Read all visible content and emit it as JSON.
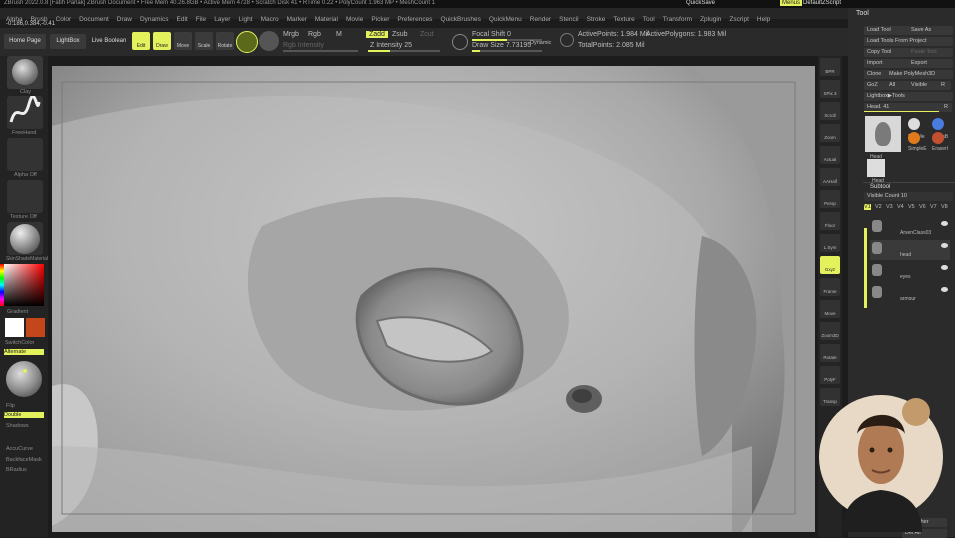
{
  "title_bar": {
    "text": "ZBrush 2022.0.8 [Fatih Parlak]   ZBrush Document   • Free Mem 40.26.8GB • Active Mem 4728 • Scratch Disk 41 • RTime 0.22 • PolyCount 1.963 MP • MeshCount 1"
  },
  "quick_buttons": {
    "quicksave": "QuickSave",
    "menus": "Menus",
    "default_script": "DefaultZScript"
  },
  "menu_items": [
    "Alpha",
    "Brush",
    "Color",
    "Document",
    "Draw",
    "Dynamics",
    "Edit",
    "File",
    "Layer",
    "Light",
    "Macro",
    "Marker",
    "Material",
    "Movie",
    "Picker",
    "Preferences",
    "QuickBrushes",
    "QuickMenu",
    "Render",
    "Stencil",
    "Stroke",
    "Texture",
    "Tool",
    "Transform",
    "Zplugin",
    "Zscript",
    "Help"
  ],
  "coordinates": "-0.186,0.384,-0.41",
  "shelf": {
    "home_page": "Home Page",
    "lightbox": "LightBox",
    "live_boolean": "Live Boolean",
    "edit": "Edit",
    "draw": "Draw",
    "move": "Move",
    "scale": "Scale",
    "rotate": "Rotate",
    "mrgb": "Mrgb",
    "rgb": "Rgb",
    "m": "M",
    "zadd": "Zadd",
    "zsub": "Zsub",
    "zcut": "Zcut",
    "rgb_intensity": "Rgb Intensity",
    "z_intensity": "Z Intensity 25",
    "focal_shift": "Focal Shift 0",
    "draw_size": "Draw Size 7.73195",
    "dynamic": "Dynamic",
    "active_points": "ActivePoints: 1.984 Mil",
    "active_polygons": "ActivePolygons: 1.983 Mil",
    "total_points": "TotalPoints: 2.085 Mil"
  },
  "left_panel": {
    "clay": "Clay",
    "freehand": "FreeHand",
    "alpha_off": "Alpha Off",
    "texture_off": "Texture Off",
    "material": "SkinShadeMaterial",
    "gradient": "Gradient",
    "switch_color": "SwitchColor",
    "alternate": "Alternate",
    "flip": "Flip",
    "double": "Double",
    "shadows": "Shadows",
    "accucurve": "AccuCurve",
    "backface": "BackfaceMask",
    "bradius": "BRadius",
    "colors": {
      "primary": "#ffffff",
      "secondary": "#c4471c",
      "accent": "#e3f15c"
    }
  },
  "right_strip": [
    "BPR",
    "SPix 3",
    "Scroll",
    "Zoom",
    "Actual",
    "AAHalf",
    "Persp",
    "Floor",
    "L.Sym",
    "Gxyz",
    "Frame",
    "Move",
    "Zoom3D",
    "Rotate",
    "PolyF",
    "Transp"
  ],
  "tool_panel": {
    "header": "Tool",
    "load_tool": "Load Tool",
    "save_as": "Save As",
    "load_from_project": "Load Tools From Project",
    "copy_tool": "Copy Tool",
    "paste_tool": "Paste Tool",
    "import": "Import",
    "export": "Export",
    "clone": "Clone",
    "make_polymesh": "Make PolyMesh3D",
    "goz": "GoZ",
    "all": "All",
    "visible": "Visible",
    "r": "R",
    "lightbox_tools": "Lightbox▶Tools",
    "head_slider": "Head. 41",
    "r2": "R",
    "thumbs": [
      "Head",
      "PolyMe",
      "AlphaB",
      "SimpleE",
      "EraserI",
      "Head"
    ],
    "subtool": "Subtool",
    "visible_count": "Visible Count 10",
    "v_levels": [
      "V1",
      "V2",
      "V3",
      "V4",
      "V5",
      "V6",
      "V7",
      "V8"
    ],
    "subtools": [
      "ArsenClass03",
      "head",
      "eyes",
      "armour"
    ],
    "del_other": "Del Other",
    "del_all": "Del All"
  }
}
